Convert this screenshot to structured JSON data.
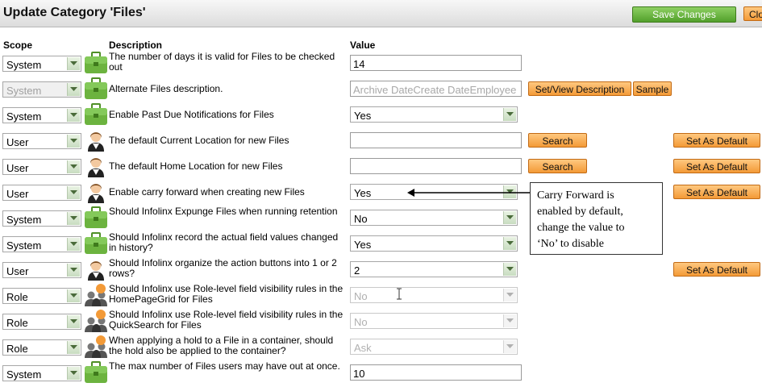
{
  "window": {
    "title": "Update Category 'Files'"
  },
  "toolbar": {
    "save_label": "Save Changes",
    "close_label": "Clo"
  },
  "headers": {
    "scope": "Scope",
    "description": "Description",
    "value": "Value"
  },
  "rows": [
    {
      "scope": "System",
      "scope_disabled": false,
      "icon": "briefcase-icon",
      "description": "The number of days it is valid for Files to be checked out",
      "value_type": "input",
      "value": "14",
      "value_disabled": false
    },
    {
      "scope": "System",
      "scope_disabled": true,
      "icon": "briefcase-icon",
      "description": "Alternate Files description.",
      "value_type": "input",
      "value": "Archive DateCreate DateEmployee S",
      "value_disabled": true,
      "buttons": [
        "Set/View Description",
        "Sample"
      ]
    },
    {
      "scope": "System",
      "scope_disabled": false,
      "icon": "briefcase-icon",
      "description": "Enable Past Due Notifications for Files",
      "value_type": "select",
      "value": "Yes",
      "value_disabled": false
    },
    {
      "scope": "User",
      "scope_disabled": false,
      "icon": "user-icon",
      "description": "The default Current Location for new Files",
      "value_type": "input",
      "value": "",
      "value_disabled": false,
      "buttons": [
        "Search"
      ],
      "default_button": "Set As Default"
    },
    {
      "scope": "User",
      "scope_disabled": false,
      "icon": "user-icon",
      "description": "The default Home Location for new Files",
      "value_type": "input",
      "value": "",
      "value_disabled": false,
      "buttons": [
        "Search"
      ],
      "default_button": "Set As Default"
    },
    {
      "scope": "User",
      "scope_disabled": false,
      "icon": "user-icon",
      "description": "Enable carry forward when creating new Files",
      "value_type": "select",
      "value": "Yes",
      "value_disabled": false,
      "default_button": "Set As Default"
    },
    {
      "scope": "System",
      "scope_disabled": false,
      "icon": "briefcase-icon",
      "description": "Should Infolinx Expunge Files when running retention",
      "value_type": "select",
      "value": "No",
      "value_disabled": false
    },
    {
      "scope": "System",
      "scope_disabled": false,
      "icon": "briefcase-icon",
      "description": "Should Infolinx record the actual field values changed in history?",
      "value_type": "select",
      "value": "Yes",
      "value_disabled": false
    },
    {
      "scope": "User",
      "scope_disabled": false,
      "icon": "user-icon",
      "description": "Should Infolinx organize the action buttons into 1 or 2 rows?",
      "value_type": "select",
      "value": "2",
      "value_disabled": false,
      "default_button": "Set As Default"
    },
    {
      "scope": "Role",
      "scope_disabled": false,
      "icon": "role-group-icon",
      "description": "Should Infolinx use Role-level field visibility rules in the HomePageGrid for Files",
      "value_type": "select",
      "value": "No",
      "value_disabled": true
    },
    {
      "scope": "Role",
      "scope_disabled": false,
      "icon": "role-group-icon",
      "description": "Should Infolinx use Role-level field visibility rules in the QuickSearch for Files",
      "value_type": "select",
      "value": "No",
      "value_disabled": true
    },
    {
      "scope": "Role",
      "scope_disabled": false,
      "icon": "role-group-icon",
      "description": "When applying a hold to a File in a container, should the hold also be applied to the container?",
      "value_type": "select",
      "value": "Ask",
      "value_disabled": true
    },
    {
      "scope": "System",
      "scope_disabled": false,
      "icon": "briefcase-icon",
      "description": "The max number of Files users may have out at once.",
      "value_type": "input",
      "value": "10",
      "value_disabled": false
    }
  ],
  "callout": {
    "lines": [
      "Carry Forward is",
      "enabled by default,",
      "change the value to",
      "‘No’ to disable"
    ]
  },
  "colors": {
    "green_button": "#52a02b",
    "orange_button": "#f39a37",
    "briefcase": "#6cb33f"
  }
}
